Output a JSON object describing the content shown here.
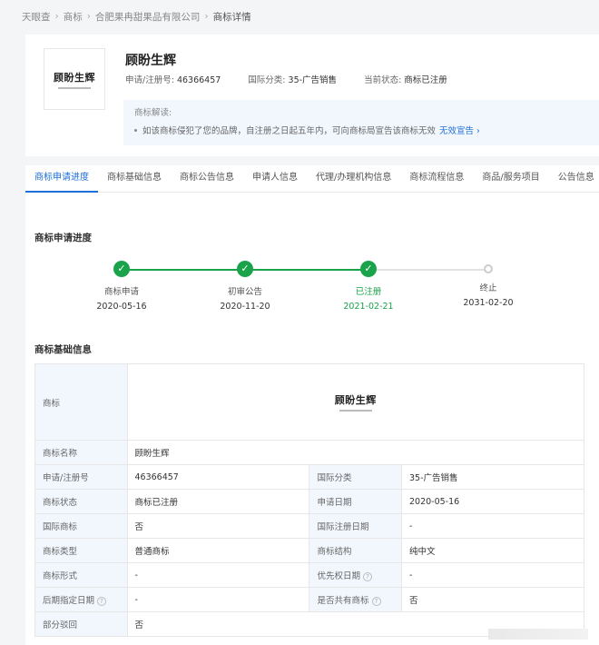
{
  "breadcrumb": [
    "天眼查",
    "商标",
    "合肥果冉甜果品有限公司",
    "商标详情"
  ],
  "header": {
    "logo_text": "顾盼生辉",
    "title": "顾盼生辉",
    "reg_no_label": "申请/注册号:",
    "reg_no": "46366457",
    "intl_class_label": "国际分类:",
    "intl_class": "35-广告销售",
    "status_label": "当前状态:",
    "status": "商标已注册"
  },
  "notice": {
    "title": "商标解读:",
    "body": "如该商标侵犯了您的品牌，自注册之日起五年内，可向商标局宣告该商标无效",
    "link": "无效宣告 ›"
  },
  "tabs": [
    "商标申请进度",
    "商标基础信息",
    "商标公告信息",
    "申请人信息",
    "代理/办理机构信息",
    "商标流程信息",
    "商品/服务项目",
    "公告信息"
  ],
  "progress_title": "商标申请进度",
  "steps": [
    {
      "label": "商标申请",
      "date": "2020-05-16"
    },
    {
      "label": "初审公告",
      "date": "2020-11-20"
    },
    {
      "label": "已注册",
      "date": "2021-02-21"
    },
    {
      "label": "终止",
      "date": "2031-02-20"
    }
  ],
  "info_title": "商标基础信息",
  "table": {
    "logo_label": "商标",
    "name_label": "商标名称",
    "name": "顾盼生辉",
    "reg_no_label": "申请/注册号",
    "reg_no": "46366457",
    "intl_class_label": "国际分类",
    "intl_class": "35-广告销售",
    "status_label": "商标状态",
    "status": "商标已注册",
    "apply_date_label": "申请日期",
    "apply_date": "2020-05-16",
    "intl_tm_label": "国际商标",
    "intl_tm": "否",
    "intl_reg_date_label": "国际注册日期",
    "intl_reg_date": "-",
    "type_label": "商标类型",
    "type": "普通商标",
    "structure_label": "商标结构",
    "structure": "纯中文",
    "form_label": "商标形式",
    "form": "-",
    "priority_date_label": "优先权日期",
    "priority_date": "-",
    "later_date_label": "后期指定日期",
    "later_date": "-",
    "shared_label": "是否共有商标",
    "shared": "否",
    "partial_reject_label": "部分驳回",
    "partial_reject": "否"
  },
  "colors": {
    "accent": "#1e6fd9",
    "done": "#1aa34a",
    "label_bg": "#f2f7fe"
  }
}
